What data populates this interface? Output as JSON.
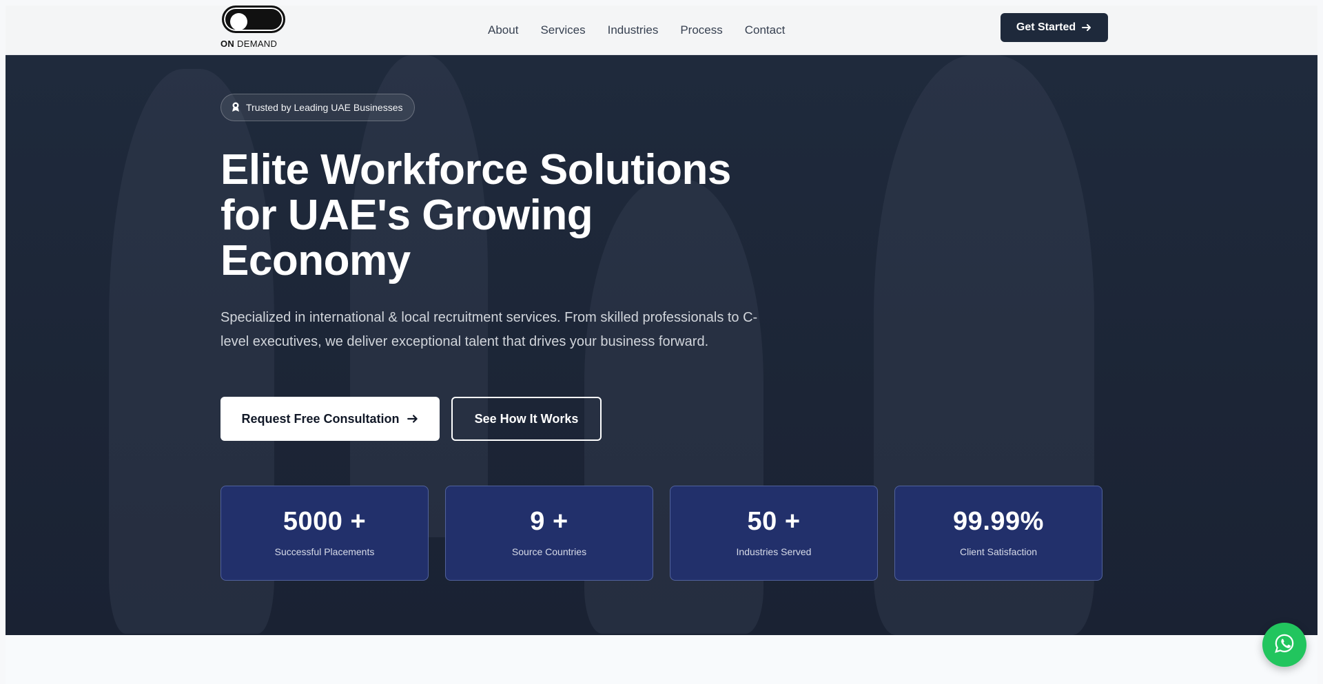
{
  "header": {
    "logo_text_bold": "ON",
    "logo_text": "DEMAND",
    "nav": [
      {
        "label": "About"
      },
      {
        "label": "Services"
      },
      {
        "label": "Industries"
      },
      {
        "label": "Process"
      },
      {
        "label": "Contact"
      }
    ],
    "cta_label": "Get Started"
  },
  "hero": {
    "badge": "Trusted by Leading UAE Businesses",
    "title_line1": "Elite Workforce Solutions",
    "title_line2": "for UAE's Growing",
    "title_line3": "Economy",
    "subtitle": "Specialized in international & local recruitment services. From skilled professionals to C-level executives, we deliver exceptional talent that drives your business forward.",
    "primary_button": "Request Free Consultation",
    "secondary_button": "See How It Works"
  },
  "stats": [
    {
      "value": "5000",
      "suffix": "+",
      "label": "Successful Placements"
    },
    {
      "value": "9",
      "suffix": "+",
      "label": "Source Countries"
    },
    {
      "value": "50",
      "suffix": "+",
      "label": "Industries Served"
    },
    {
      "value": "99.99",
      "suffix": "%",
      "label": "Client Satisfaction"
    }
  ],
  "colors": {
    "nav_cta_bg": "#1e293b",
    "hero_bg": "#1f2a3c",
    "stat_card_bg": "#22306b",
    "whatsapp": "#22c55e"
  },
  "icons": {
    "badge_icon": "award-icon",
    "cta_arrow": "arrow-right-icon",
    "whatsapp": "whatsapp-icon"
  }
}
